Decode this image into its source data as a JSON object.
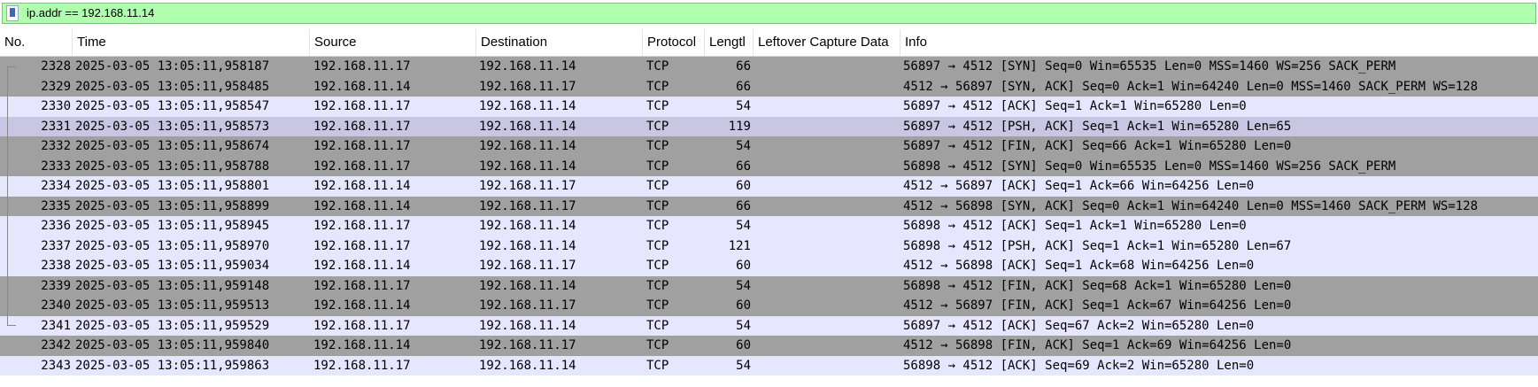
{
  "filter": {
    "value": "ip.addr == 192.168.11.14",
    "bookmark_icon": "bookmark-icon"
  },
  "columns": [
    "No.",
    "Time",
    "Source",
    "Destination",
    "Protocol",
    "Lengtl",
    "Leftover Capture Data",
    "Info"
  ],
  "colors": {
    "gray": "#a0a0a0",
    "light": "#e7e6ff",
    "mid": "#c8c6e2",
    "filter_bg": "#afffaf"
  },
  "rows": [
    {
      "no": "2328",
      "time": "2025-03-05 13:05:11,958187",
      "src": "192.168.11.17",
      "dst": "192.168.11.14",
      "proto": "TCP",
      "len": "66",
      "info": "56897 → 4512 [SYN] Seq=0 Win=65535 Len=0 MSS=1460 WS=256 SACK_PERM",
      "shade": "gray"
    },
    {
      "no": "2329",
      "time": "2025-03-05 13:05:11,958485",
      "src": "192.168.11.14",
      "dst": "192.168.11.17",
      "proto": "TCP",
      "len": "66",
      "info": "4512 → 56897 [SYN, ACK] Seq=0 Ack=1 Win=64240 Len=0 MSS=1460 SACK_PERM WS=128",
      "shade": "gray"
    },
    {
      "no": "2330",
      "time": "2025-03-05 13:05:11,958547",
      "src": "192.168.11.17",
      "dst": "192.168.11.14",
      "proto": "TCP",
      "len": "54",
      "info": "56897 → 4512 [ACK] Seq=1 Ack=1 Win=65280 Len=0",
      "shade": "light"
    },
    {
      "no": "2331",
      "time": "2025-03-05 13:05:11,958573",
      "src": "192.168.11.17",
      "dst": "192.168.11.14",
      "proto": "TCP",
      "len": "119",
      "info": "56897 → 4512 [PSH, ACK] Seq=1 Ack=1 Win=65280 Len=65",
      "shade": "mid"
    },
    {
      "no": "2332",
      "time": "2025-03-05 13:05:11,958674",
      "src": "192.168.11.17",
      "dst": "192.168.11.14",
      "proto": "TCP",
      "len": "54",
      "info": "56897 → 4512 [FIN, ACK] Seq=66 Ack=1 Win=65280 Len=0",
      "shade": "gray"
    },
    {
      "no": "2333",
      "time": "2025-03-05 13:05:11,958788",
      "src": "192.168.11.17",
      "dst": "192.168.11.14",
      "proto": "TCP",
      "len": "66",
      "info": "56898 → 4512 [SYN] Seq=0 Win=65535 Len=0 MSS=1460 WS=256 SACK_PERM",
      "shade": "gray"
    },
    {
      "no": "2334",
      "time": "2025-03-05 13:05:11,958801",
      "src": "192.168.11.14",
      "dst": "192.168.11.17",
      "proto": "TCP",
      "len": "60",
      "info": "4512 → 56897 [ACK] Seq=1 Ack=66 Win=64256 Len=0",
      "shade": "light"
    },
    {
      "no": "2335",
      "time": "2025-03-05 13:05:11,958899",
      "src": "192.168.11.14",
      "dst": "192.168.11.17",
      "proto": "TCP",
      "len": "66",
      "info": "4512 → 56898 [SYN, ACK] Seq=0 Ack=1 Win=64240 Len=0 MSS=1460 SACK_PERM WS=128",
      "shade": "gray"
    },
    {
      "no": "2336",
      "time": "2025-03-05 13:05:11,958945",
      "src": "192.168.11.17",
      "dst": "192.168.11.14",
      "proto": "TCP",
      "len": "54",
      "info": "56898 → 4512 [ACK] Seq=1 Ack=1 Win=65280 Len=0",
      "shade": "light"
    },
    {
      "no": "2337",
      "time": "2025-03-05 13:05:11,958970",
      "src": "192.168.11.17",
      "dst": "192.168.11.14",
      "proto": "TCP",
      "len": "121",
      "info": "56898 → 4512 [PSH, ACK] Seq=1 Ack=1 Win=65280 Len=67",
      "shade": "light"
    },
    {
      "no": "2338",
      "time": "2025-03-05 13:05:11,959034",
      "src": "192.168.11.14",
      "dst": "192.168.11.17",
      "proto": "TCP",
      "len": "60",
      "info": "4512 → 56898 [ACK] Seq=1 Ack=68 Win=64256 Len=0",
      "shade": "light"
    },
    {
      "no": "2339",
      "time": "2025-03-05 13:05:11,959148",
      "src": "192.168.11.17",
      "dst": "192.168.11.14",
      "proto": "TCP",
      "len": "54",
      "info": "56898 → 4512 [FIN, ACK] Seq=68 Ack=1 Win=65280 Len=0",
      "shade": "gray"
    },
    {
      "no": "2340",
      "time": "2025-03-05 13:05:11,959513",
      "src": "192.168.11.14",
      "dst": "192.168.11.17",
      "proto": "TCP",
      "len": "60",
      "info": "4512 → 56897 [FIN, ACK] Seq=1 Ack=67 Win=64256 Len=0",
      "shade": "gray"
    },
    {
      "no": "2341",
      "time": "2025-03-05 13:05:11,959529",
      "src": "192.168.11.17",
      "dst": "192.168.11.14",
      "proto": "TCP",
      "len": "54",
      "info": "56897 → 4512 [ACK] Seq=67 Ack=2 Win=65280 Len=0",
      "shade": "light"
    },
    {
      "no": "2342",
      "time": "2025-03-05 13:05:11,959840",
      "src": "192.168.11.14",
      "dst": "192.168.11.17",
      "proto": "TCP",
      "len": "60",
      "info": "4512 → 56898 [FIN, ACK] Seq=1 Ack=69 Win=64256 Len=0",
      "shade": "gray"
    },
    {
      "no": "2343",
      "time": "2025-03-05 13:05:11,959863",
      "src": "192.168.11.17",
      "dst": "192.168.11.14",
      "proto": "TCP",
      "len": "54",
      "info": "56898 → 4512 [ACK] Seq=69 Ack=2 Win=65280 Len=0",
      "shade": "light"
    }
  ]
}
